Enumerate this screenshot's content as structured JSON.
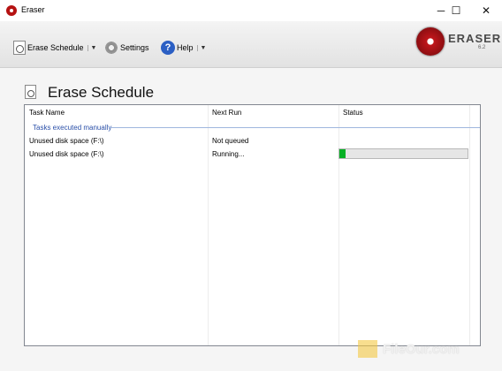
{
  "window": {
    "title": "Eraser"
  },
  "window_controls": {
    "minimize": "─",
    "maximize": "☐",
    "close": "✕"
  },
  "toolbar": {
    "erase_schedule": "Erase Schedule",
    "settings": "Settings",
    "help": "Help",
    "dropdown_arrow": "▼"
  },
  "logo": {
    "name": "ERASER",
    "version": "6.2"
  },
  "page": {
    "title": "Erase Schedule"
  },
  "tasks": {
    "columns": [
      "Task Name",
      "Next Run",
      "Status"
    ],
    "group_label": "Tasks executed manually",
    "rows": [
      {
        "task_name": "Unused disk space (F:\\)",
        "next_run": "Not queued",
        "status": ""
      },
      {
        "task_name": "Unused disk space (F:\\)",
        "next_run": "Running...",
        "status": "progress",
        "progress": 0.05
      }
    ]
  },
  "colors": {
    "progress_fill": "#06b025",
    "group_label": "#2a4fa8",
    "logo_red": "#c0161b"
  },
  "watermark": {
    "text": "FileOur.com"
  }
}
